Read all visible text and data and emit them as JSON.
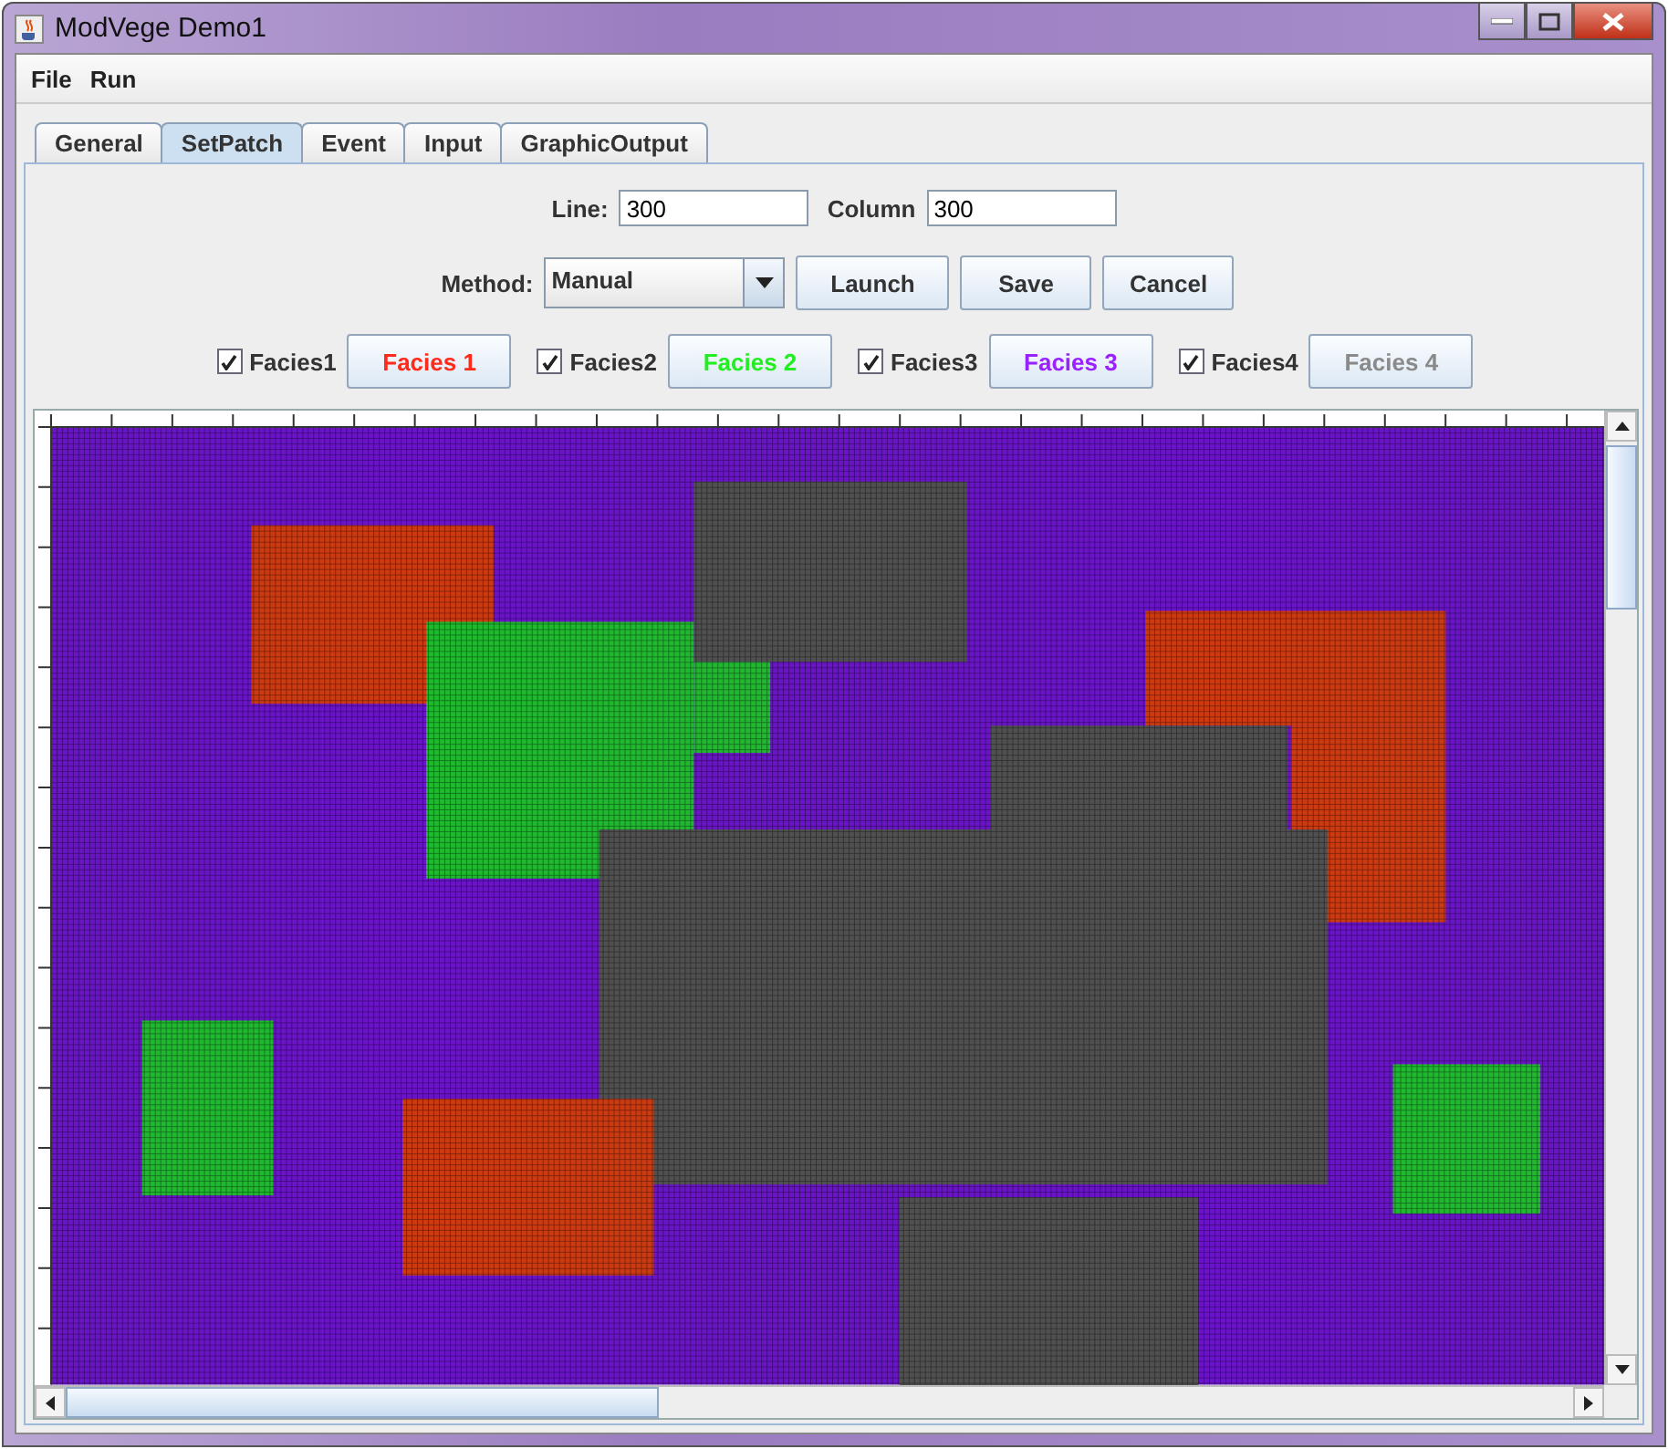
{
  "window": {
    "title": "ModVege Demo1"
  },
  "menu": [
    "File",
    "Run"
  ],
  "tabs": [
    {
      "label": "General",
      "selected": false
    },
    {
      "label": "SetPatch",
      "selected": true
    },
    {
      "label": "Event",
      "selected": false
    },
    {
      "label": "Input",
      "selected": false
    },
    {
      "label": "GraphicOutput",
      "selected": false
    }
  ],
  "line": {
    "label": "Line:",
    "value": "300"
  },
  "column": {
    "label": "Column",
    "value": "300"
  },
  "method": {
    "label": "Method:",
    "value": "Manual"
  },
  "buttons": [
    "Launch",
    "Save",
    "Cancel"
  ],
  "facies": [
    {
      "label": "Facies1",
      "checked": true,
      "button": "Facies 1",
      "color": "#ff2a1a"
    },
    {
      "label": "Facies2",
      "checked": true,
      "button": "Facies 2",
      "color": "#22ee22"
    },
    {
      "label": "Facies3",
      "checked": true,
      "button": "Facies 3",
      "color": "#9a22ff"
    },
    {
      "label": "Facies4",
      "checked": true,
      "button": "Facies 4",
      "color": "#8a8a8a"
    }
  ]
}
